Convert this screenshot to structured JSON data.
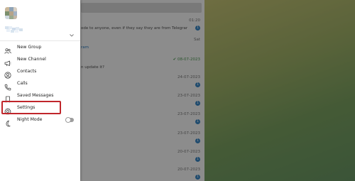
{
  "menu": {
    "items": [
      {
        "label": "New Group",
        "icon": "people-icon"
      },
      {
        "label": "New Channel",
        "icon": "megaphone-icon"
      },
      {
        "label": "Contacts",
        "icon": "contact-icon"
      },
      {
        "label": "Calls",
        "icon": "phone-icon"
      },
      {
        "label": "Saved Messages",
        "icon": "bookmark-icon"
      },
      {
        "label": "Settings",
        "icon": "gear-icon"
      },
      {
        "label": "Night Mode",
        "icon": "moon-icon"
      }
    ],
    "night_mode_on": false,
    "highlighted_item": "Settings"
  },
  "chats": [
    {
      "time": "01:20",
      "snippet": "ode to anyone, even if they say they are from Telegram. This...",
      "badge": "1"
    },
    {
      "time": "Sat",
      "snippet": "ram",
      "link": true
    },
    {
      "time": "✔ 08-07-2023",
      "snippet": "n update it?",
      "read": true
    },
    {
      "time": "24-07-2023",
      "snippet": "",
      "badge": "1"
    },
    {
      "time": "23-07-2023",
      "snippet": "",
      "badge": "1"
    },
    {
      "time": "23-07-2023",
      "snippet": "",
      "badge": "1"
    },
    {
      "time": "23-07-2023",
      "snippet": "",
      "badge": "1"
    },
    {
      "time": "20-07-2023",
      "snippet": "",
      "badge": "1"
    },
    {
      "time": "20-07-2023",
      "snippet": "",
      "badge": "1"
    },
    {
      "time": "20-07-2023",
      "snippet": "",
      "badge": "1"
    }
  ],
  "colors": {
    "accent_highlight": "#c0262b",
    "badge": "#3a89c9",
    "link": "#2a7bc0"
  }
}
